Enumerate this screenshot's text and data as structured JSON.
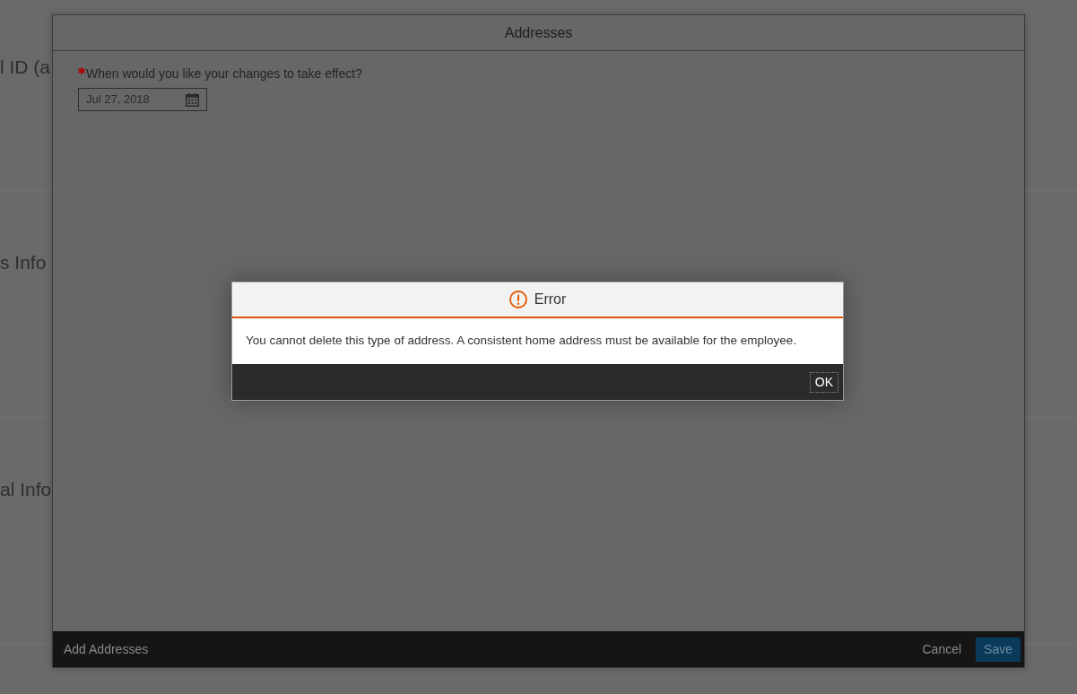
{
  "background_page": {
    "sections": [
      {
        "title": "l ID (a"
      },
      {
        "title": "s Info"
      },
      {
        "title": "al Info"
      }
    ]
  },
  "dialog": {
    "title": "Addresses",
    "field": {
      "label": "When would you like your changes to take effect?",
      "required": true,
      "value": "Jul 27, 2018"
    },
    "footer": {
      "title": "Add Addresses",
      "cancel_button": "Cancel",
      "save_button": "Save"
    }
  },
  "error_dialog": {
    "title": "Error",
    "message": "You cannot delete this type of address. A consistent home address must be available for the employee.",
    "ok_button": {
      "label": "OK",
      "focused": true
    }
  }
}
